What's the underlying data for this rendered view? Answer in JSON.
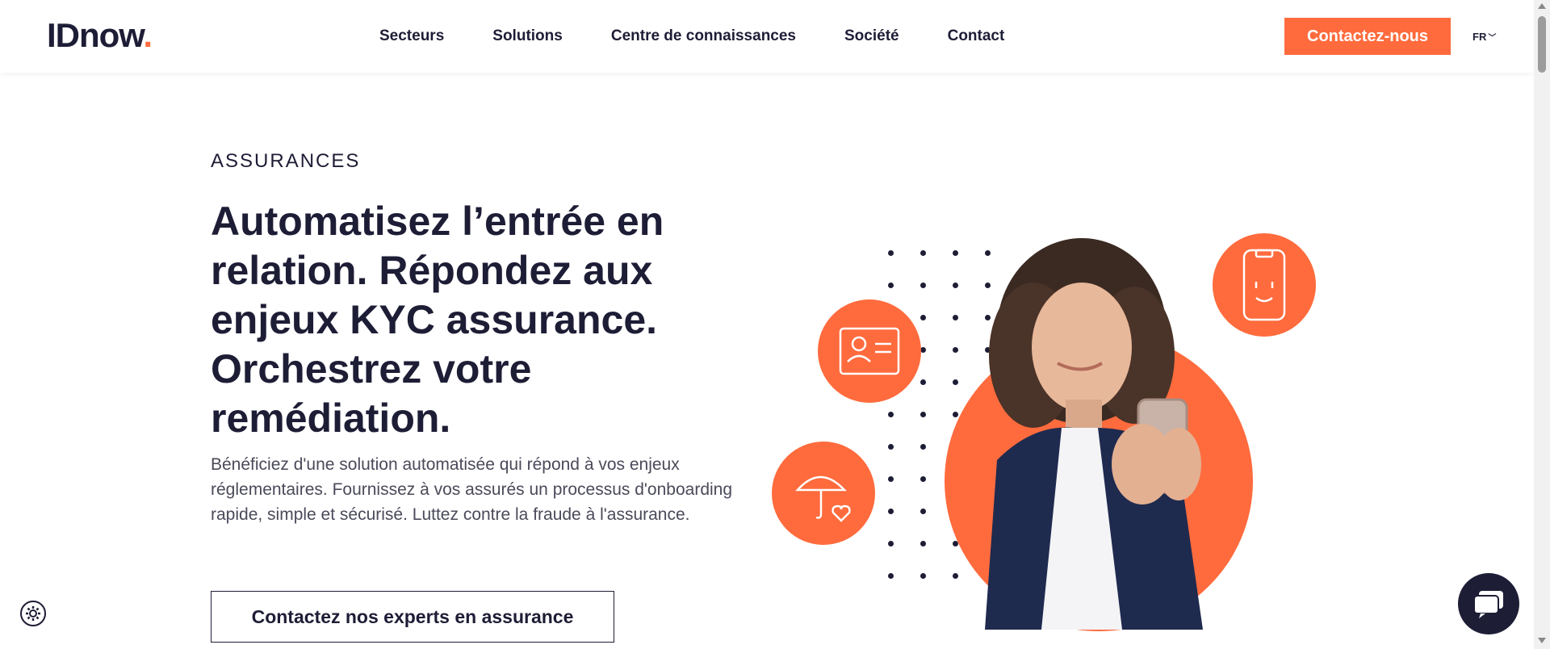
{
  "brand": {
    "logo_text": "IDnow",
    "logo_dot": ".",
    "accent_color": "#ff6b3d",
    "text_color": "#1e1d36"
  },
  "nav": {
    "items": [
      {
        "label": "Secteurs"
      },
      {
        "label": "Solutions"
      },
      {
        "label": "Centre de connaissances"
      },
      {
        "label": "Société"
      },
      {
        "label": "Contact"
      }
    ],
    "cta_label": "Contactez-nous",
    "language": "FR",
    "language_icon": "chevron-down-icon"
  },
  "hero": {
    "eyebrow": "ASSURANCES",
    "headline": "Automatisez l’entrée en relation. Répondez aux enjeux KYC assurance. Orchestrez votre remédiation.",
    "description": "Bénéficiez d'une solution automatisée qui répond à vos enjeux réglementaires. Fournissez à vos assurés un processus d'onboarding rapide, simple et sécurisé. Luttez contre la fraude à l'assurance.",
    "cta_label": "Contactez nos experts en assurance"
  },
  "illustration": {
    "icons": [
      "id-card-icon",
      "umbrella-heart-icon",
      "phone-face-icon"
    ],
    "photo": "woman-with-smartphone"
  },
  "widgets": {
    "settings_icon": "gear-icon",
    "chat_icon": "chat-bubble-icon"
  }
}
